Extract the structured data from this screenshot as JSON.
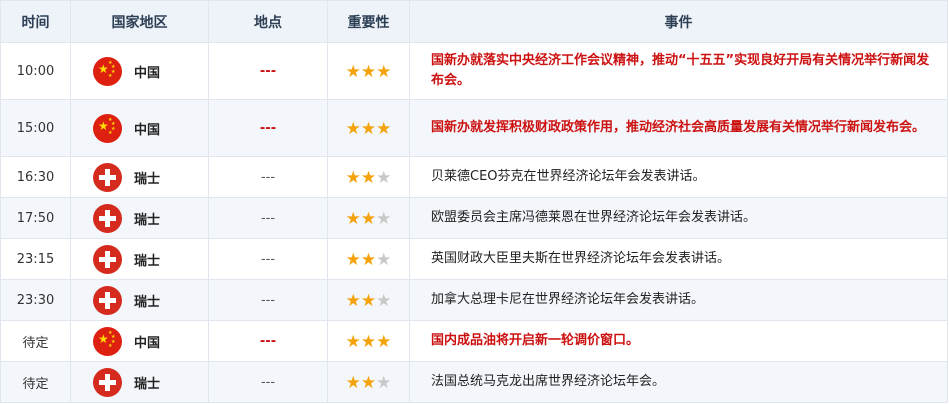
{
  "header": {
    "time": "时间",
    "country": "国家地区",
    "location": "地点",
    "importance": "重要性",
    "event": "事件"
  },
  "colors": {
    "high_text": "#cc1111",
    "star_on": "#f5a30c",
    "star_off": "#c8c8c8",
    "china_flag": "#de2010",
    "swiss_flag": "#d52b1e"
  },
  "rows": [
    {
      "time": "10:00",
      "country": "中国",
      "flag": "china-flag-icon",
      "location": "---",
      "stars": 3,
      "event": "国新办就落实中央经济工作会议精神，推动“十五五”实现良好开局有关情况举行新闻发布会。"
    },
    {
      "time": "15:00",
      "country": "中国",
      "flag": "china-flag-icon",
      "location": "---",
      "stars": 3,
      "event": "国新办就发挥积极财政政策作用，推动经济社会高质量发展有关情况举行新闻发布会。"
    },
    {
      "time": "16:30",
      "country": "瑞士",
      "flag": "switzerland-flag-icon",
      "location": "---",
      "stars": 2,
      "event": "贝莱德CEO芬克在世界经济论坛年会发表讲话。"
    },
    {
      "time": "17:50",
      "country": "瑞士",
      "flag": "switzerland-flag-icon",
      "location": "---",
      "stars": 2,
      "event": "欧盟委员会主席冯德莱恩在世界经济论坛年会发表讲话。"
    },
    {
      "time": "23:15",
      "country": "瑞士",
      "flag": "switzerland-flag-icon",
      "location": "---",
      "stars": 2,
      "event": "英国财政大臣里夫斯在世界经济论坛年会发表讲话。"
    },
    {
      "time": "23:30",
      "country": "瑞士",
      "flag": "switzerland-flag-icon",
      "location": "---",
      "stars": 2,
      "event": "加拿大总理卡尼在世界经济论坛年会发表讲话。"
    },
    {
      "time": "待定",
      "country": "中国",
      "flag": "china-flag-icon",
      "location": "---",
      "stars": 3,
      "event": "国内成品油将开启新一轮调价窗口。"
    },
    {
      "time": "待定",
      "country": "瑞士",
      "flag": "switzerland-flag-icon",
      "location": "---",
      "stars": 2,
      "event": "法国总统马克龙出席世界经济论坛年会。"
    }
  ]
}
